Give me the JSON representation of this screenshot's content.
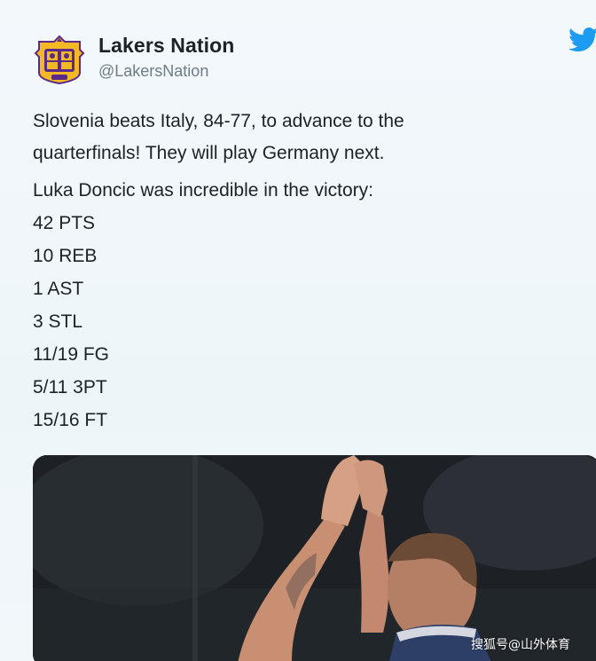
{
  "tweet": {
    "author_name": "Lakers Nation",
    "author_handle": "@LakersNation",
    "avatar_icon": "lakers-nation-crest-icon",
    "platform_icon": "twitter-bird-icon",
    "brand_color": "#1d9bf0",
    "text_line_1": "Slovenia beats Italy, 84-77, to advance to the",
    "text_line_2": "quarterfinals! They will play Germany next.",
    "text_line_3": "Luka Doncic was incredible in the victory:",
    "stats": [
      "42 PTS",
      "10 REB",
      "1 AST",
      "3 STL",
      "11/19 FG",
      "5/11 3PT",
      "15/16 FT"
    ]
  },
  "media": {
    "description_icon": "basketball-player-photo"
  },
  "watermark": {
    "text": "搜狐号@山外体育"
  }
}
